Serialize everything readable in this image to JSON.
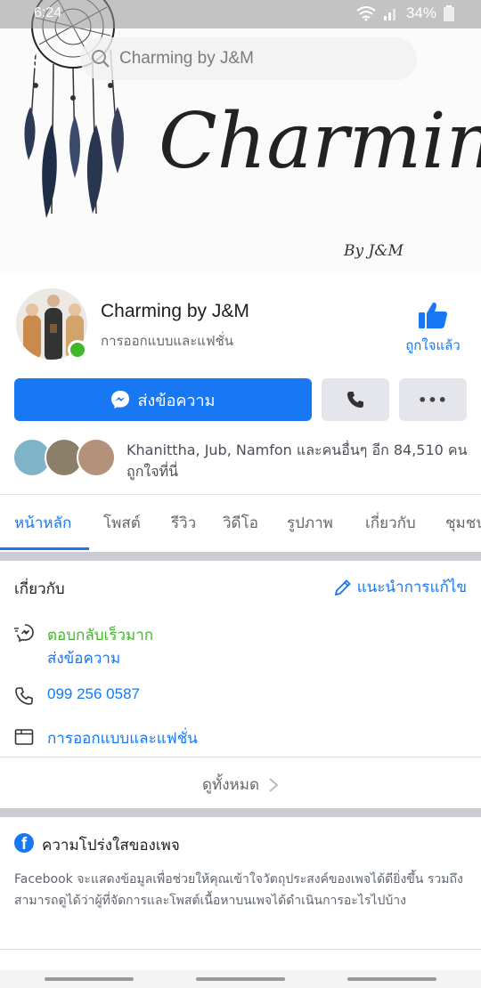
{
  "status_bar": {
    "time": "6:24",
    "battery": "34%"
  },
  "search": {
    "placeholder": "Charming by J&M"
  },
  "cover": {
    "title_art": "Charming",
    "byline": "By J&M"
  },
  "page": {
    "name": "Charming by J&M",
    "category": "การออกแบบและแฟชั่น",
    "like_label": "ถูกใจแล้ว",
    "message_label": "ส่งข้อความ",
    "likes_line1": "Khanittha, Jub, Namfon และคนอื่นๆ อีก 84,510 คน",
    "likes_line2": "ถูกใจที่นี่"
  },
  "tabs": [
    {
      "label": "หน้าหลัก"
    },
    {
      "label": "โพสต์"
    },
    {
      "label": "รีวิว"
    },
    {
      "label": "วิดีโอ"
    },
    {
      "label": "รูปภาพ"
    },
    {
      "label": "เกี่ยวกับ"
    },
    {
      "label": "ชุมชน"
    }
  ],
  "about": {
    "title": "เกี่ยวกับ",
    "suggest_edit": "แนะนำการแก้ไข",
    "quick_reply": "ตอบกลับเร็วมาก",
    "send_message": "ส่งข้อความ",
    "phone": "099 256 0587",
    "category": "การออกแบบและแฟชั่น",
    "see_all": "ดูทั้งหมด"
  },
  "transparency": {
    "title": "ความโปร่งใสของเพจ",
    "body": "Facebook จะแสดงข้อมูลเพื่อช่วยให้คุณเข้าใจวัตถุประสงค์ของเพจได้ดียิ่งขึ้น รวมถึงสามารถดูได้ว่าผู้ที่จัดการและโพสต์เนื้อหาบนเพจได้ดำเนินการอะไรไปบ้าง"
  },
  "colors": {
    "accent": "#1877f2",
    "online": "#42b72a",
    "button_gray": "#e4e6eb"
  },
  "icons": [
    "search-icon",
    "wifi-icon",
    "signal-icon",
    "battery-icon",
    "like-thumb-icon",
    "messenger-icon",
    "phone-icon",
    "more-icon",
    "pencil-icon",
    "quick-reply-icon",
    "phone-row-icon",
    "category-icon",
    "chevron-right-icon",
    "facebook-icon"
  ]
}
